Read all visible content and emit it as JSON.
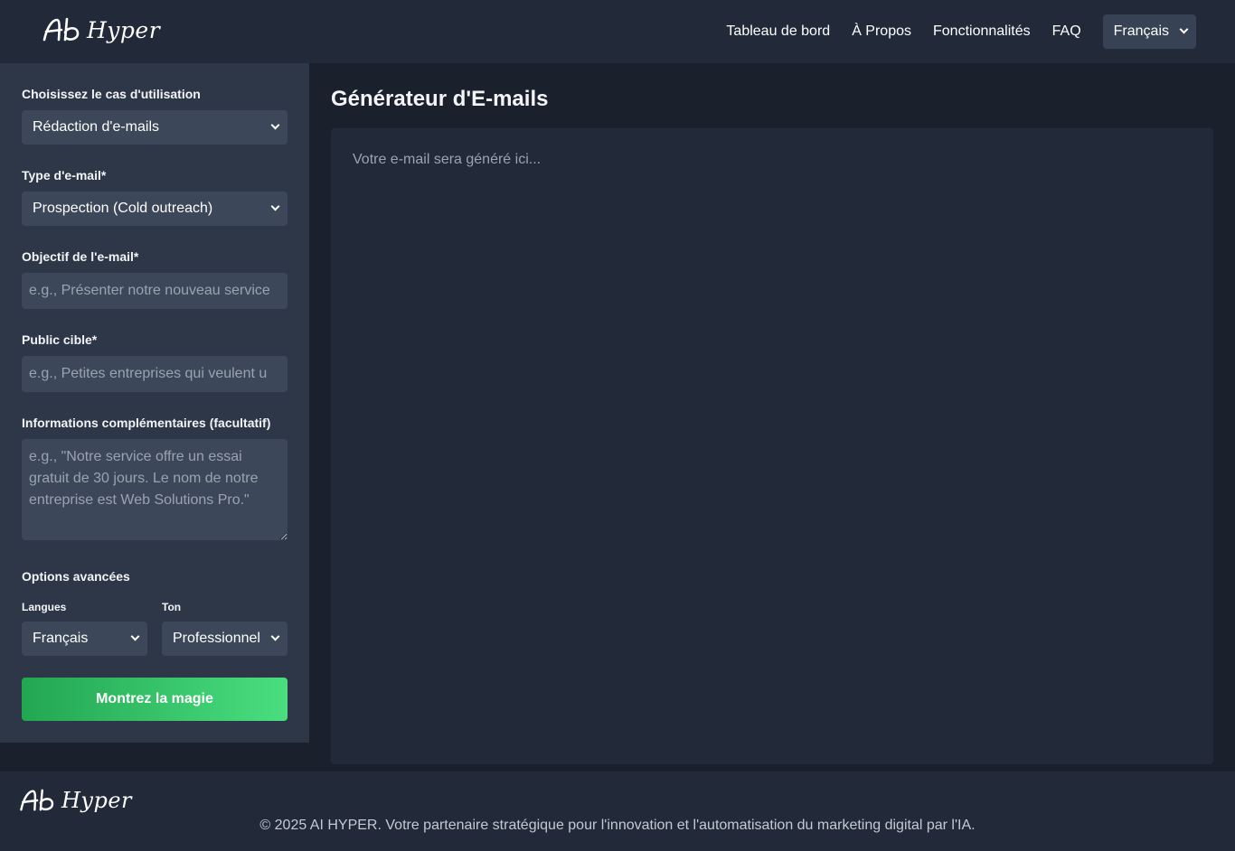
{
  "header": {
    "logo_text": "Hyper",
    "nav": [
      "Tableau de bord",
      "À Propos",
      "Fonctionnalités",
      "FAQ"
    ],
    "language": "Français"
  },
  "sidebar": {
    "use_case": {
      "label": "Choisissez le cas d'utilisation",
      "value": "Rédaction d'e-mails"
    },
    "email_type": {
      "label": "Type d'e-mail*",
      "value": "Prospection (Cold outreach)"
    },
    "objective": {
      "label": "Objectif de l'e-mail*",
      "placeholder": "e.g., Présenter notre nouveau service"
    },
    "audience": {
      "label": "Public cible*",
      "placeholder": "e.g., Petites entreprises qui veulent u"
    },
    "extra": {
      "label": "Informations complémentaires (facultatif)",
      "placeholder": "e.g., \"Notre service offre un essai gratuit de 30 jours. Le nom de notre entreprise est Web Solutions Pro.\""
    },
    "advanced": {
      "label": "Options avancées",
      "languages_label": "Langues",
      "languages_value": "Français",
      "tone_label": "Ton",
      "tone_value": "Professionnel"
    },
    "submit_label": "Montrez la magie"
  },
  "main": {
    "title": "Générateur d'E-mails",
    "output_placeholder": "Votre e-mail sera généré ici..."
  },
  "footer": {
    "logo_text": "Hyper",
    "copyright": "© 2025 AI HYPER. Votre partenaire stratégique pour l'innovation et l'automatisation du marketing digital par l'IA."
  },
  "icons": [
    "ai-logo-icon",
    "chevron-down-icon"
  ],
  "colors": {
    "background": "#1a202c",
    "panel": "#2e3748",
    "header": "#222a3a",
    "field": "#3c4759",
    "accent_start": "#22a652",
    "accent_end": "#4ade80"
  }
}
